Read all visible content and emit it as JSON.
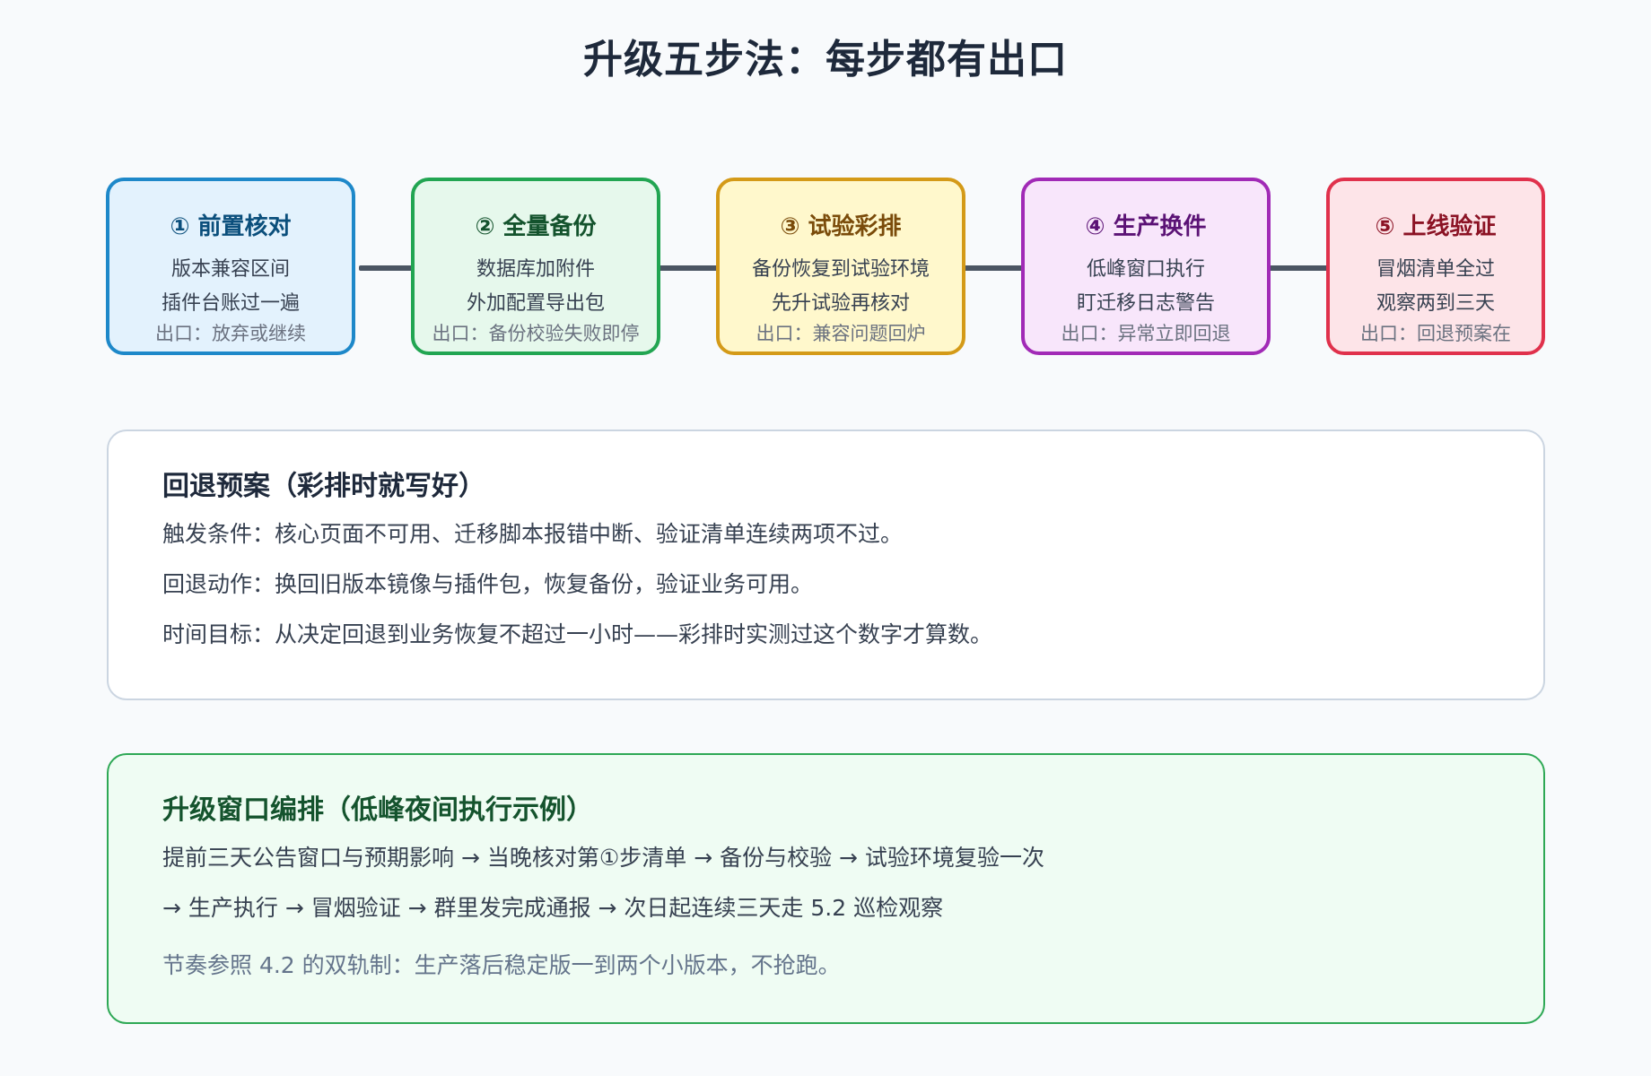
{
  "title": "升级五步法：每步都有出口",
  "steps": [
    {
      "title": "① 前置核对",
      "line1": "版本兼容区间",
      "line2": "插件台账过一遍",
      "exit": "出口：放弃或继续",
      "color": "#1e88c9"
    },
    {
      "title": "② 全量备份",
      "line1": "数据库加附件",
      "line2": "外加配置导出包",
      "exit": "出口：备份校验失败即停",
      "color": "#22a552"
    },
    {
      "title": "③ 试验彩排",
      "line1": "备份恢复到试验环境",
      "line2": "先升试验再核对",
      "exit": "出口：兼容问题回炉",
      "color": "#d49a18"
    },
    {
      "title": "④ 生产换件",
      "line1": "低峰窗口执行",
      "line2": "盯迁移日志警告",
      "exit": "出口：异常立即回退",
      "color": "#a12ab6"
    },
    {
      "title": "⑤ 上线验证",
      "line1": "冒烟清单全过",
      "line2": "观察两到三天",
      "exit": "出口：回退预案在",
      "color": "#e0314c"
    }
  ],
  "rollback": {
    "title": "回退预案（彩排时就写好）",
    "lines": [
      "触发条件：核心页面不可用、迁移脚本报错中断、验证清单连续两项不过。",
      "回退动作：换回旧版本镜像与插件包，恢复备份，验证业务可用。",
      "时间目标：从决定回退到业务恢复不超过一小时——彩排时实测过这个数字才算数。"
    ]
  },
  "schedule": {
    "title": "升级窗口编排（低峰夜间执行示例）",
    "lines": [
      "提前三天公告窗口与预期影响 → 当晚核对第①步清单 → 备份与校验 → 试验环境复验一次",
      "→ 生产执行 → 冒烟验证 → 群里发完成通报 → 次日起连续三天走 5.2 巡检观察"
    ],
    "note": "节奏参照 4.2 的双轨制：生产落后稳定版一到两个小版本，不抢跑。"
  }
}
